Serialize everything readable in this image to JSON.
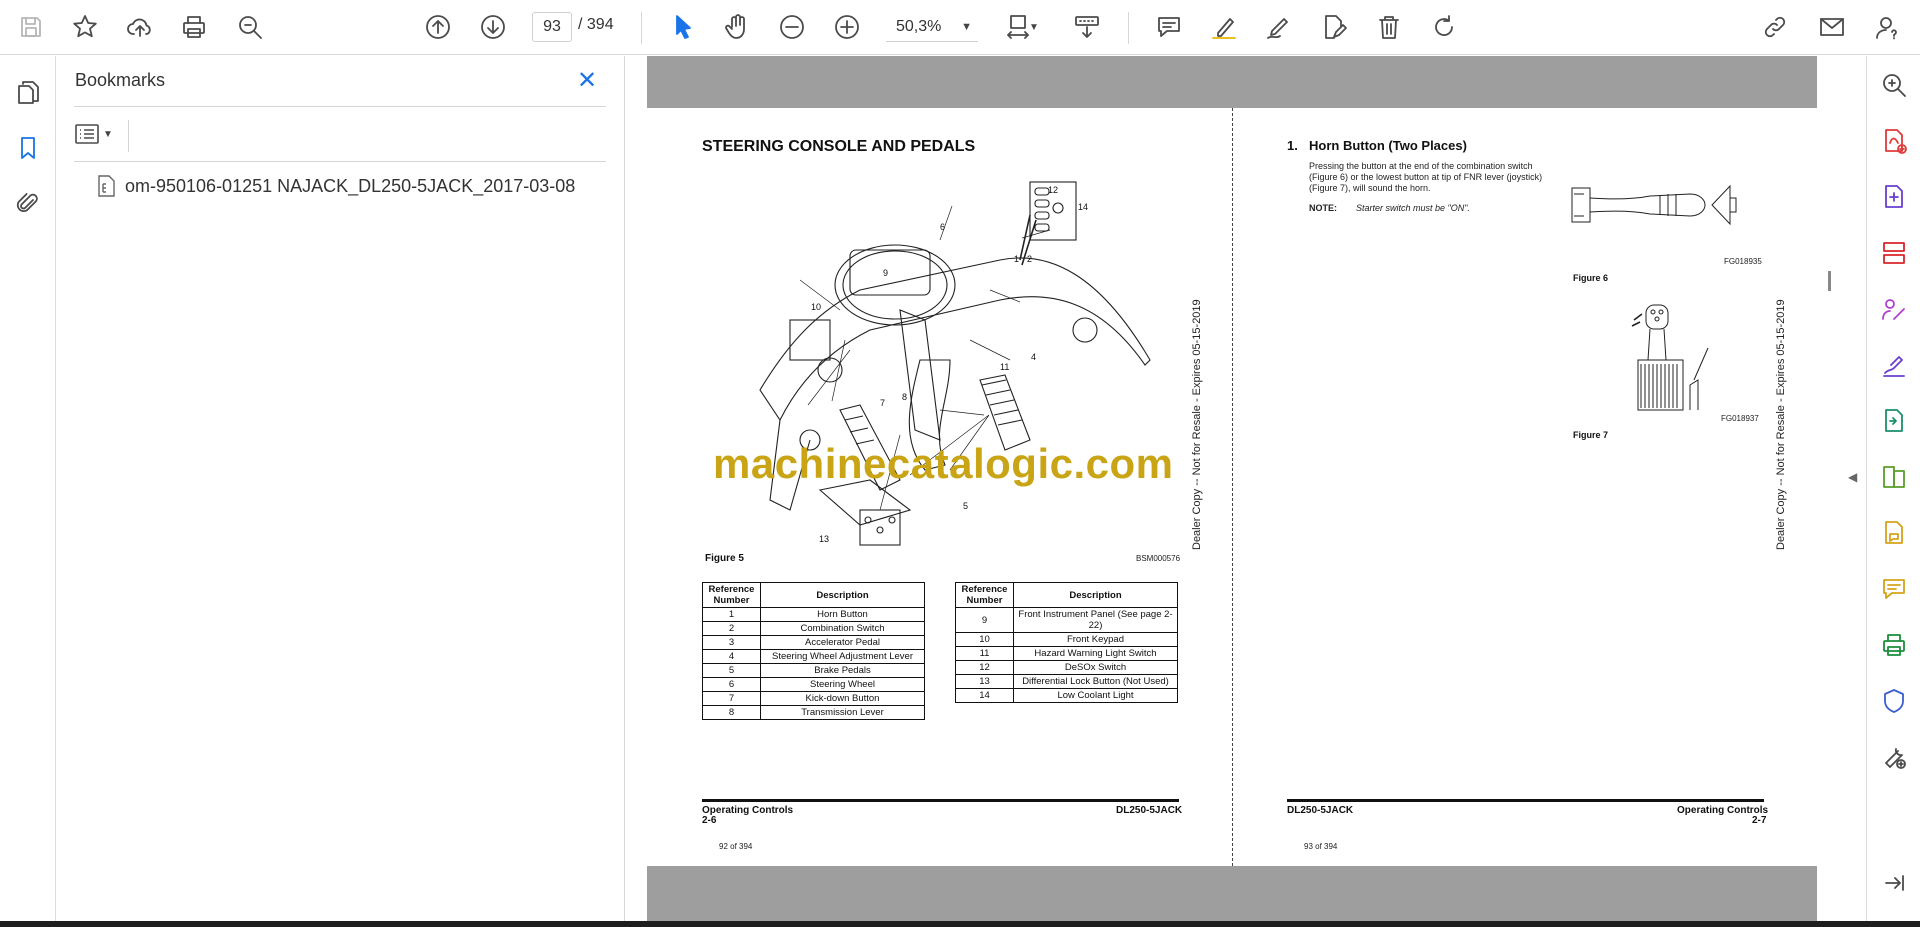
{
  "toolbar": {
    "page_current": "93",
    "page_separator": "/",
    "page_total": "394",
    "zoom": "50,3%"
  },
  "bookmarks": {
    "title": "Bookmarks",
    "items": [
      {
        "label": "om-950106-01251 NAJACK_DL250-5JACK_2017-03-08"
      }
    ]
  },
  "left_page": {
    "heading": "STEERING CONSOLE AND PEDALS",
    "figure_caption": "Figure 5",
    "figure_code": "BSM000576",
    "callouts": [
      "1",
      "2",
      "4",
      "5",
      "6",
      "7",
      "8",
      "9",
      "10",
      "11",
      "12",
      "13",
      "14"
    ],
    "table_headers": [
      "Reference Number",
      "Description"
    ],
    "table_left": [
      [
        "1",
        "Horn Button"
      ],
      [
        "2",
        "Combination Switch"
      ],
      [
        "3",
        "Accelerator Pedal"
      ],
      [
        "4",
        "Steering Wheel Adjustment Lever"
      ],
      [
        "5",
        "Brake Pedals"
      ],
      [
        "6",
        "Steering Wheel"
      ],
      [
        "7",
        "Kick-down Button"
      ],
      [
        "8",
        "Transmission Lever"
      ]
    ],
    "table_right": [
      [
        "9",
        "Front Instrument Panel (See page 2-22)"
      ],
      [
        "10",
        "Front Keypad"
      ],
      [
        "11",
        "Hazard Warning Light Switch"
      ],
      [
        "12",
        "DeSOx Switch"
      ],
      [
        "13",
        "Differential Lock Button (Not Used)"
      ],
      [
        "14",
        "Low Coolant Light"
      ]
    ],
    "footer_left_title": "Operating Controls",
    "footer_left_page": "2-6",
    "footer_right": "DL250-5JACK",
    "page_counter": "92 of 394",
    "side_stamp": "Dealer Copy -- Not for Resale - Expires 05-15-2019"
  },
  "right_page": {
    "heading_num": "1.",
    "heading": "Horn Button (Two Places)",
    "body": "Pressing the button at the end of the combination switch (Figure 6) or the lowest button at tip of FNR lever (joystick) (Figure 7), will sound the horn.",
    "note_label": "NOTE:",
    "note_text": "Starter switch must be \"ON\".",
    "fig6_code": "FG018935",
    "fig6_caption": "Figure 6",
    "fig7_code": "FG018937",
    "fig7_caption": "Figure 7",
    "footer_left": "DL250-5JACK",
    "footer_right_title": "Operating Controls",
    "footer_right_page": "2-7",
    "page_counter": "93 of 394",
    "side_stamp": "Dealer Copy -- Not for Resale - Expires 05-15-2019"
  },
  "watermark": "machinecatalogic.com",
  "colors": {
    "accent": "#1a73e8",
    "gutter": "#9e9e9e",
    "watermark": "#c9a415"
  }
}
